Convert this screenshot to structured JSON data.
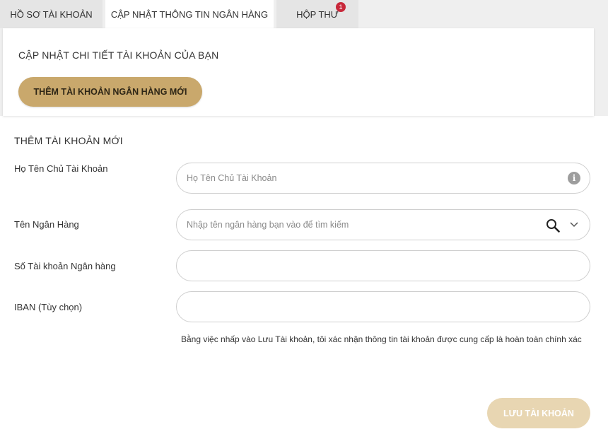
{
  "tabs": [
    {
      "label": "HỒ SƠ TÀI KHOẢN",
      "active": false
    },
    {
      "label": "CẬP NHẬT THÔNG TIN NGÂN HÀNG",
      "active": true
    },
    {
      "label": "HỘP THƯ",
      "active": false,
      "badge": "1"
    }
  ],
  "card": {
    "title": "CẬP NHẬT CHI TIẾT TÀI KHOẢN CỦA BẠN",
    "add_button": "THÊM TÀI KHOẢN NGÂN HÀNG MỚI"
  },
  "form": {
    "title": "THÊM TÀI KHOẢN MỚI",
    "holder": {
      "label": "Họ Tên Chủ Tài Khoản",
      "placeholder": "Họ Tên Chủ Tài Khoản",
      "icon": "info-icon",
      "info_glyph": "i"
    },
    "bank": {
      "label": "Tên Ngân Hàng",
      "placeholder": "Nhập tên ngân hàng bạn vào để tìm kiếm",
      "icons": [
        "search-icon",
        "chevron-down-icon"
      ]
    },
    "account_number": {
      "label": "Số Tài khoản Ngân hàng",
      "value": ""
    },
    "iban": {
      "label": "IBAN (Tùy chọn)",
      "value": ""
    },
    "disclaimer": "Bằng việc nhấp vào Lưu Tài khoản, tôi xác nhận thông tin tài khoản được cung cấp là hoàn toàn chính xác",
    "save_button": "LƯU TÀI KHOẢN"
  },
  "colors": {
    "accent": "#c9a86c",
    "accent_disabled": "#e8d6b2",
    "badge": "#c8283a",
    "tab_inactive": "#e5e5e5",
    "background_band": "#efefef"
  }
}
